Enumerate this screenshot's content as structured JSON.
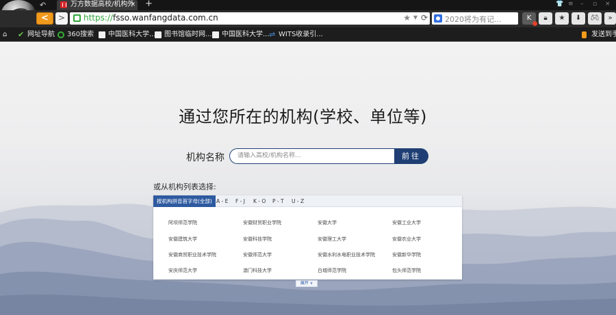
{
  "browser": {
    "tab_title": "万方数据高校/机构外",
    "tab_close": "×",
    "new_tab": "+",
    "back_label": "<",
    "forward_label": ">",
    "url_scheme": "https://",
    "url_host": "fsso.wanfangdata.com.cn",
    "search_placeholder": "2020将为有记...",
    "accent_color": "#f19a1c"
  },
  "bookmarks": [
    {
      "label": "网址导航",
      "icon": "check-icon"
    },
    {
      "label": "360搜索",
      "icon": "360-icon"
    },
    {
      "label": "中国医科大学...",
      "icon": "doc-icon"
    },
    {
      "label": "图书馆临时网...",
      "icon": "doc-icon"
    },
    {
      "label": "中国医科大学...",
      "icon": "doc-icon"
    },
    {
      "label": "WITS收录引...",
      "icon": "wits-icon"
    }
  ],
  "send_to_phone": "发送到手",
  "page": {
    "heading": "通过您所在的机构(学校、单位等)",
    "institution_label": "机构名称",
    "institution_placeholder": "请输入高校/机构名称...",
    "submit_label": "前往",
    "list_label": "或从机构列表选择:",
    "tabs": [
      "按机构拼音首字母(全部)",
      "A - E",
      "F - J",
      "K - O",
      "P - T",
      "U - Z"
    ],
    "institutions": [
      [
        "阿坝师范学院",
        "安徽财贸职业学院",
        "安徽大学",
        "安徽工业大学"
      ],
      [
        "安徽建筑大学",
        "安徽科技学院",
        "安徽理工大学",
        "安徽农业大学"
      ],
      [
        "安徽商贸职业技术学院",
        "安徽师范大学",
        "安徽水利水电职业技术学院",
        "安徽新华学院"
      ],
      [
        "安庆师范大学",
        "澳门科技大学",
        "白城师范学院",
        "包头师范学院"
      ]
    ],
    "expand_label": "展开 ∨"
  },
  "colors": {
    "primary": "#1f3f74",
    "tab_active": "#2d5aa0",
    "secure": "#2fa43b"
  }
}
